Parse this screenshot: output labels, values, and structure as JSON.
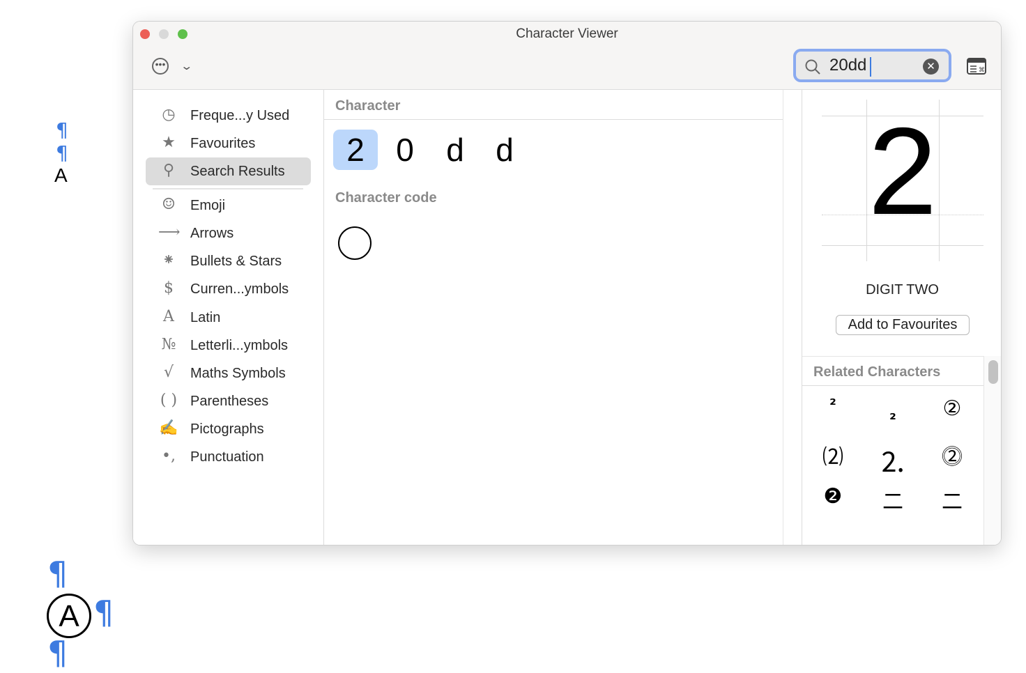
{
  "outside": {
    "pilcrow": "¶",
    "letter": "A",
    "circled_letter": "A"
  },
  "window": {
    "title": "Character Viewer"
  },
  "toolbar": {
    "more_icon": "ellipsis-circle-icon",
    "chevron_icon": "chevron-down-icon",
    "search_value": "20dd",
    "keyboard_viewer_icon": "keyboard-viewer-icon"
  },
  "sidebar": {
    "items": [
      {
        "icon": "◷",
        "label": "Freque...y Used"
      },
      {
        "icon": "★",
        "label": "Favourites"
      },
      {
        "icon": "⚲",
        "label": "Search Results",
        "selected": true
      },
      {
        "icon": "☺",
        "label": "Emoji"
      },
      {
        "icon": "⟶",
        "label": "Arrows"
      },
      {
        "icon": "⁕",
        "label": "Bullets & Stars"
      },
      {
        "icon": "$",
        "label": "Curren...ymbols"
      },
      {
        "icon": "A",
        "label": "Latin"
      },
      {
        "icon": "№",
        "label": "Letterli...ymbols"
      },
      {
        "icon": "√",
        "label": "Maths Symbols"
      },
      {
        "icon": "( )",
        "label": "Parentheses"
      },
      {
        "icon": "✍",
        "label": "Pictographs"
      },
      {
        "icon": "•,",
        "label": "Punctuation"
      }
    ]
  },
  "main": {
    "character_header": "Character",
    "characters": [
      "2",
      "0",
      "d",
      "d"
    ],
    "selected_index": 0,
    "code_header": "Character code",
    "code_char": "◯"
  },
  "detail": {
    "glyph": "2",
    "name": "DIGIT TWO",
    "add_favourites": "Add to Favourites",
    "related_header": "Related Characters",
    "related": [
      "²",
      "₂",
      "②",
      "⑵",
      "⒉",
      "⓶",
      "❷",
      "二",
      "⼆"
    ]
  },
  "colors": {
    "accent": "#3d7be0",
    "selection": "#bcd7fb",
    "search_focus": "#8aaaf0"
  }
}
